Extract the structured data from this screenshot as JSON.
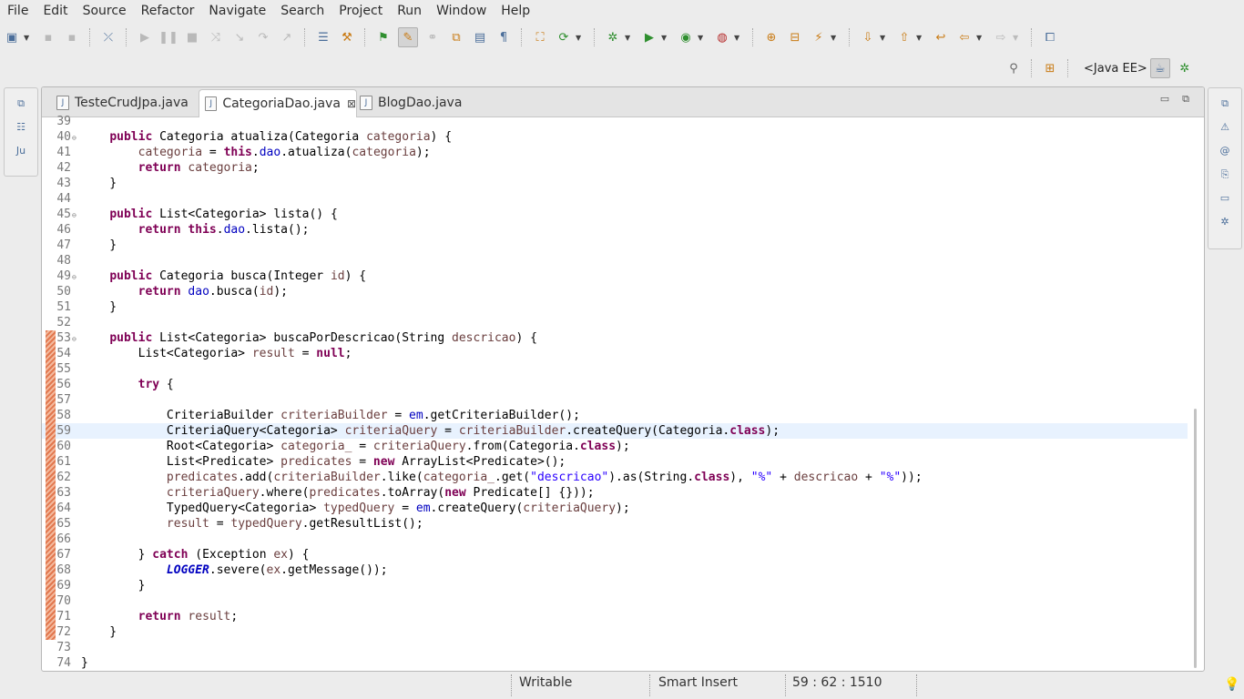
{
  "menu": [
    "File",
    "Edit",
    "Source",
    "Refactor",
    "Navigate",
    "Search",
    "Project",
    "Run",
    "Window",
    "Help"
  ],
  "perspective": {
    "label": "<Java EE>"
  },
  "tabs": [
    {
      "label": "TesteCrudJpa.java",
      "active": false
    },
    {
      "label": "CategoriaDao.java",
      "active": true,
      "close": "⊠"
    },
    {
      "label": "BlogDao.java",
      "active": false
    }
  ],
  "code_lines": [
    {
      "n": "39",
      "html": ""
    },
    {
      "n": "40",
      "fold": true,
      "html": "    <span class=\"kw\">public</span> Categoria atualiza(Categoria <span class=\"var\">categoria</span>) {"
    },
    {
      "n": "41",
      "html": "        <span class=\"var\">categoria</span> = <span class=\"kw\">this</span>.<span class=\"fld\">dao</span>.atualiza(<span class=\"var\">categoria</span>);"
    },
    {
      "n": "42",
      "html": "        <span class=\"kw\">return</span> <span class=\"var\">categoria</span>;"
    },
    {
      "n": "43",
      "html": "    }"
    },
    {
      "n": "44",
      "html": ""
    },
    {
      "n": "45",
      "fold": true,
      "html": "    <span class=\"kw\">public</span> List&lt;Categoria&gt; lista() {"
    },
    {
      "n": "46",
      "html": "        <span class=\"kw\">return</span> <span class=\"kw\">this</span>.<span class=\"fld\">dao</span>.lista();"
    },
    {
      "n": "47",
      "html": "    }"
    },
    {
      "n": "48",
      "html": ""
    },
    {
      "n": "49",
      "fold": true,
      "html": "    <span class=\"kw\">public</span> Categoria busca(Integer <span class=\"var\">id</span>) {"
    },
    {
      "n": "50",
      "html": "        <span class=\"kw\">return</span> <span class=\"fld\">dao</span>.busca(<span class=\"var\">id</span>);"
    },
    {
      "n": "51",
      "html": "    }"
    },
    {
      "n": "52",
      "html": ""
    },
    {
      "n": "53",
      "fold": true,
      "marker": true,
      "html": "    <span class=\"kw\">public</span> List&lt;Categoria&gt; buscaPorDescricao(String <span class=\"var\">descricao</span>) {"
    },
    {
      "n": "54",
      "marker": true,
      "html": "        List&lt;Categoria&gt; <span class=\"var\">result</span> = <span class=\"kw\">null</span>;"
    },
    {
      "n": "55",
      "marker": true,
      "html": ""
    },
    {
      "n": "56",
      "marker": true,
      "html": "        <span class=\"kw\">try</span> {"
    },
    {
      "n": "57",
      "marker": true,
      "html": ""
    },
    {
      "n": "58",
      "marker": true,
      "html": "            CriteriaBuilder <span class=\"var\">criteriaBuilder</span> = <span class=\"fld\">em</span>.getCriteriaBuilder();"
    },
    {
      "n": "59",
      "marker": true,
      "current": true,
      "html": "            CriteriaQuery&lt;Categoria&gt; <span class=\"var\">criteriaQuery</span> = <span class=\"var\">criteriaBuilder</span>.createQuery(Categoria.<span class=\"kw\">class</span>);"
    },
    {
      "n": "60",
      "marker": true,
      "html": "            Root&lt;Categoria&gt; <span class=\"var\">categoria_</span> = <span class=\"var\">criteriaQuery</span>.from(Categoria.<span class=\"kw\">class</span>);"
    },
    {
      "n": "61",
      "marker": true,
      "html": "            List&lt;Predicate&gt; <span class=\"var\">predicates</span> = <span class=\"kw\">new</span> ArrayList&lt;Predicate&gt;();"
    },
    {
      "n": "62",
      "marker": true,
      "html": "            <span class=\"var\">predicates</span>.add(<span class=\"var\">criteriaBuilder</span>.like(<span class=\"var\">categoria_</span>.get(<span class=\"str\">\"descricao\"</span>).as(String.<span class=\"kw\">class</span>), <span class=\"str\">\"%\"</span> + <span class=\"var\">descricao</span> + <span class=\"str\">\"%\"</span>));"
    },
    {
      "n": "63",
      "marker": true,
      "html": "            <span class=\"var\">criteriaQuery</span>.where(<span class=\"var\">predicates</span>.toArray(<span class=\"kw\">new</span> Predicate[] {}));"
    },
    {
      "n": "64",
      "marker": true,
      "html": "            TypedQuery&lt;Categoria&gt; <span class=\"var\">typedQuery</span> = <span class=\"fld\">em</span>.createQuery(<span class=\"var\">criteriaQuery</span>);"
    },
    {
      "n": "65",
      "marker": true,
      "html": "            <span class=\"var\">result</span> = <span class=\"var\">typedQuery</span>.getResultList();"
    },
    {
      "n": "66",
      "marker": true,
      "html": ""
    },
    {
      "n": "67",
      "marker": true,
      "html": "        } <span class=\"kw\">catch</span> (Exception <span class=\"var\">ex</span>) {"
    },
    {
      "n": "68",
      "marker": true,
      "html": "            <span class=\"sfld\">LOGGER</span>.severe(<span class=\"var\">ex</span>.getMessage());"
    },
    {
      "n": "69",
      "marker": true,
      "html": "        }"
    },
    {
      "n": "70",
      "marker": true,
      "html": ""
    },
    {
      "n": "71",
      "marker": true,
      "html": "        <span class=\"kw\">return</span> <span class=\"var\">result</span>;"
    },
    {
      "n": "72",
      "marker": true,
      "html": "    }"
    },
    {
      "n": "73",
      "html": ""
    },
    {
      "n": "74",
      "html": "}"
    }
  ],
  "status": {
    "writable": "Writable",
    "insert_mode": "Smart Insert",
    "position": "59 : 62 : 1510"
  },
  "colors": {
    "keyword": "#7f0055",
    "field": "#0000c0",
    "string": "#2a00ff",
    "current_line": "#e8f2fe"
  }
}
